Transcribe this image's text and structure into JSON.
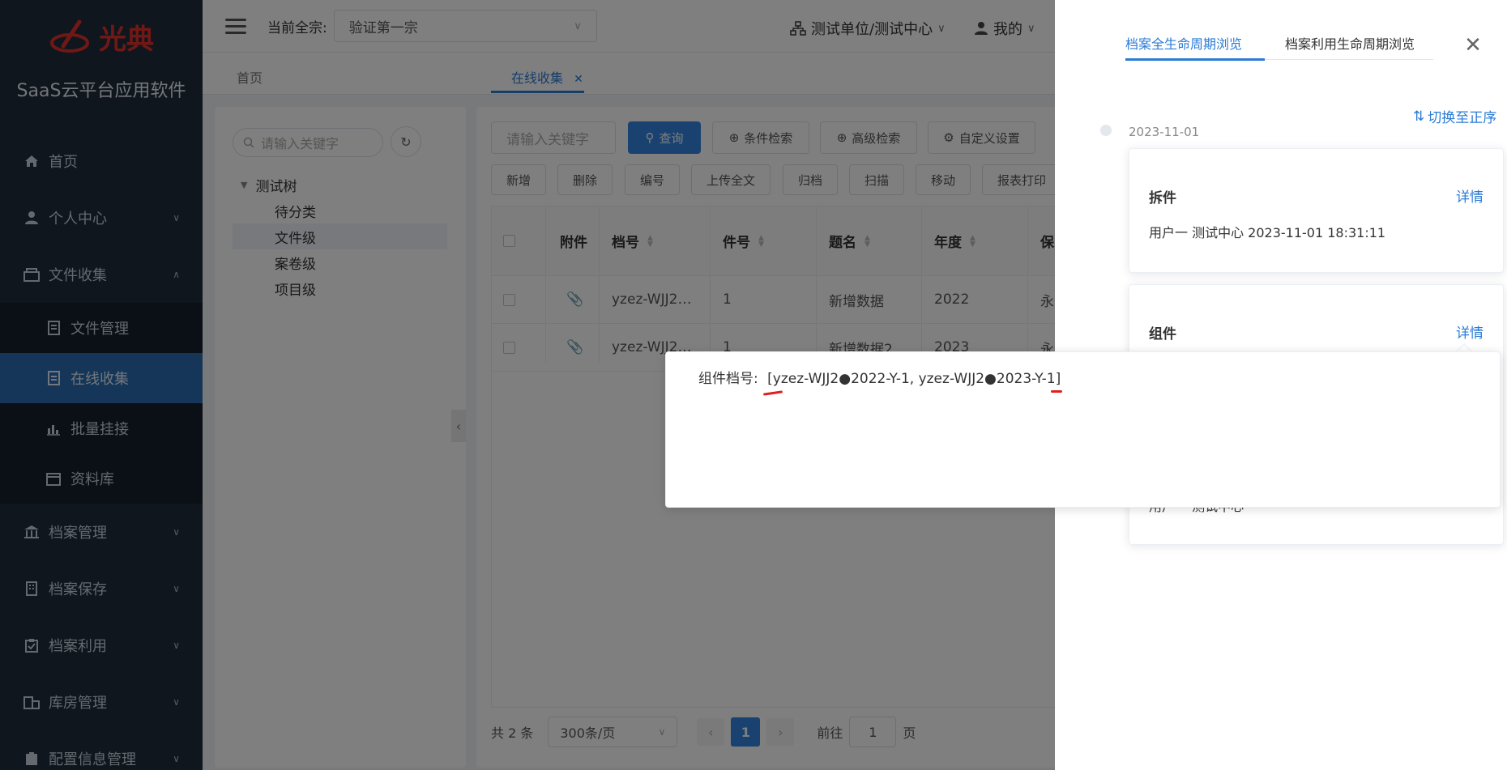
{
  "sidebar": {
    "logo_text": "光典",
    "app_name": "SaaS云平台应用软件",
    "items": [
      {
        "label": "首页",
        "icon": "home-icon"
      },
      {
        "label": "个人中心",
        "icon": "user-icon"
      },
      {
        "label": "文件收集",
        "icon": "inbox-icon"
      },
      {
        "label": "档案管理",
        "icon": "bank-icon"
      },
      {
        "label": "档案保存",
        "icon": "building-icon"
      },
      {
        "label": "档案利用",
        "icon": "clipboard-icon"
      },
      {
        "label": "库房管理",
        "icon": "warehouse-icon"
      },
      {
        "label": "配置信息管理",
        "icon": "config-icon"
      }
    ],
    "subitems": [
      {
        "label": "文件管理"
      },
      {
        "label": "在线收集"
      },
      {
        "label": "批量挂接"
      },
      {
        "label": "资料库"
      }
    ]
  },
  "header": {
    "current_label": "当前全宗:",
    "current_value": "验证第一宗",
    "unit": "测试单位/测试中心",
    "user": "我的"
  },
  "tabs": [
    {
      "label": "首页"
    },
    {
      "label": "在线收集"
    }
  ],
  "tree": {
    "search_placeholder": "请输入关键字",
    "root": "测试树",
    "children": [
      "待分类",
      "文件级",
      "案卷级",
      "项目级"
    ]
  },
  "toolbar": {
    "keyword_placeholder": "请输入关键字",
    "query": "查询",
    "cond_search": "条件检索",
    "adv_search": "高级检索",
    "custom": "自定义设置",
    "actions": [
      "新增",
      "删除",
      "编号",
      "上传全文",
      "归档",
      "扫描",
      "移动",
      "报表打印"
    ]
  },
  "table": {
    "columns": [
      "附件",
      "档号",
      "件号",
      "题名",
      "年度",
      "保"
    ],
    "rows": [
      {
        "doc_no": "yzez-WJJ2…",
        "item_no": "1",
        "title": "新增数据",
        "year": "2022",
        "keep": "永"
      },
      {
        "doc_no": "yzez-WJJ2…",
        "item_no": "1",
        "title": "新增数据2",
        "year": "2023",
        "keep": "永"
      }
    ]
  },
  "pager": {
    "total": "共 2 条",
    "page_size": "300条/页",
    "current_page": "1",
    "goto_label": "前往",
    "goto_value": "1",
    "page_unit": "页"
  },
  "drawer": {
    "tab1": "档案全生命周期浏览",
    "tab2": "档案利用生命周期浏览",
    "switch_order": "切换至正序",
    "date": "2023-11-01",
    "cards": [
      {
        "title": "拆件",
        "detail": "详情",
        "body": "用户一 测试中心 2023-11-01 18:31:11"
      },
      {
        "title": "组件",
        "detail": "详情",
        "body": "用户一 测试中心"
      }
    ]
  },
  "popover": {
    "label": "组件档号:",
    "value": "[yzez-WJJ2●2022-Y-1, yzez-WJJ2●2023-Y-1]"
  },
  "colors": {
    "sidebar_bg": "#1f2d3d",
    "accent": "#2b7bd6",
    "primary_button": "#3385e0",
    "annotation_red": "#e02020"
  }
}
